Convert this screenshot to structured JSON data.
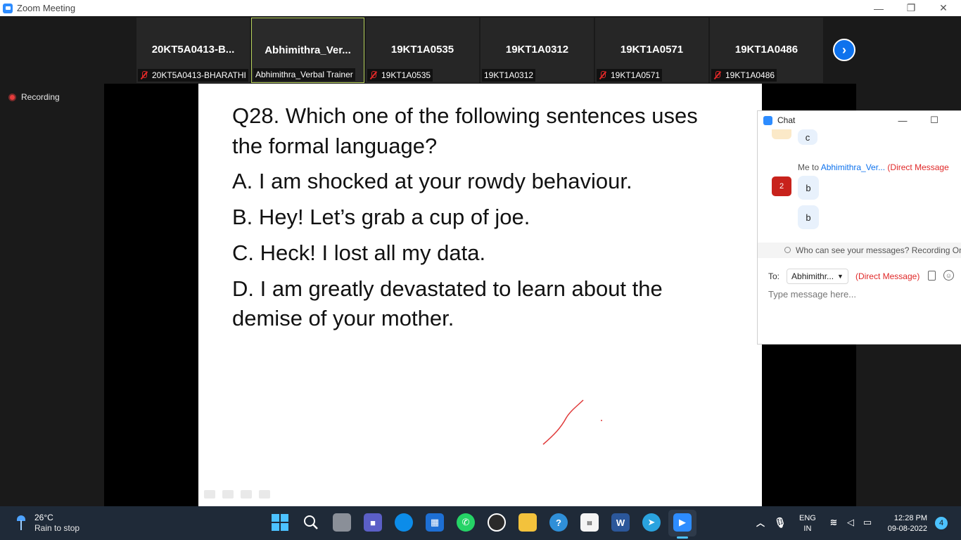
{
  "window": {
    "title": "Zoom Meeting",
    "minimize": "—",
    "restore": "❐",
    "close": "✕"
  },
  "participants": [
    {
      "display": "20KT5A0413-B...",
      "caption": "20KT5A0413-BHARATHI",
      "muted": true,
      "active": false
    },
    {
      "display": "Abhimithra_Ver...",
      "caption": "Abhimithra_Verbal Trainer",
      "muted": false,
      "active": true
    },
    {
      "display": "19KT1A0535",
      "caption": "19KT1A0535",
      "muted": true,
      "active": false
    },
    {
      "display": "19KT1A0312",
      "caption": "19KT1A0312",
      "muted": false,
      "active": false
    },
    {
      "display": "19KT1A0571",
      "caption": "19KT1A0571",
      "muted": true,
      "active": false
    },
    {
      "display": "19KT1A0486",
      "caption": "19KT1A0486",
      "muted": true,
      "active": false
    }
  ],
  "next_button": "›",
  "recording": {
    "label": "Recording"
  },
  "slide": {
    "question": "Q28. Which one of the following sentences uses the formal language?",
    "options": [
      "A. I am shocked at your rowdy behaviour.",
      "B. Hey! Let’s grab a cup of joe.",
      "C. Heck! I lost all my data.",
      "D. I am greatly devastated to learn about the demise of your mother."
    ]
  },
  "chat": {
    "title": "Chat",
    "prev_message": "c",
    "avatar_badge": "2",
    "me_to": "Me to",
    "recipient": "Abhimithra_Ver...",
    "direct_tag": "(Direct Message",
    "messages": [
      "b",
      "b"
    ],
    "visibility_note": "Who can see your messages? Recording On",
    "to_label": "To:",
    "to_value": "Abhimithr...",
    "to_direct": "(Direct Message)",
    "input_placeholder": "Type message here..."
  },
  "taskbar": {
    "weather_temp": "26°C",
    "weather_desc": "Rain to stop",
    "lang_top": "ENG",
    "lang_bottom": "IN",
    "time": "12:28 PM",
    "date": "09-08-2022",
    "notifications": "4"
  },
  "colors": {
    "zoom_blue": "#2D8CFF",
    "active_speaker": "#b8d35c",
    "muted_red": "#e02828",
    "taskbar": "#1f2a38"
  }
}
